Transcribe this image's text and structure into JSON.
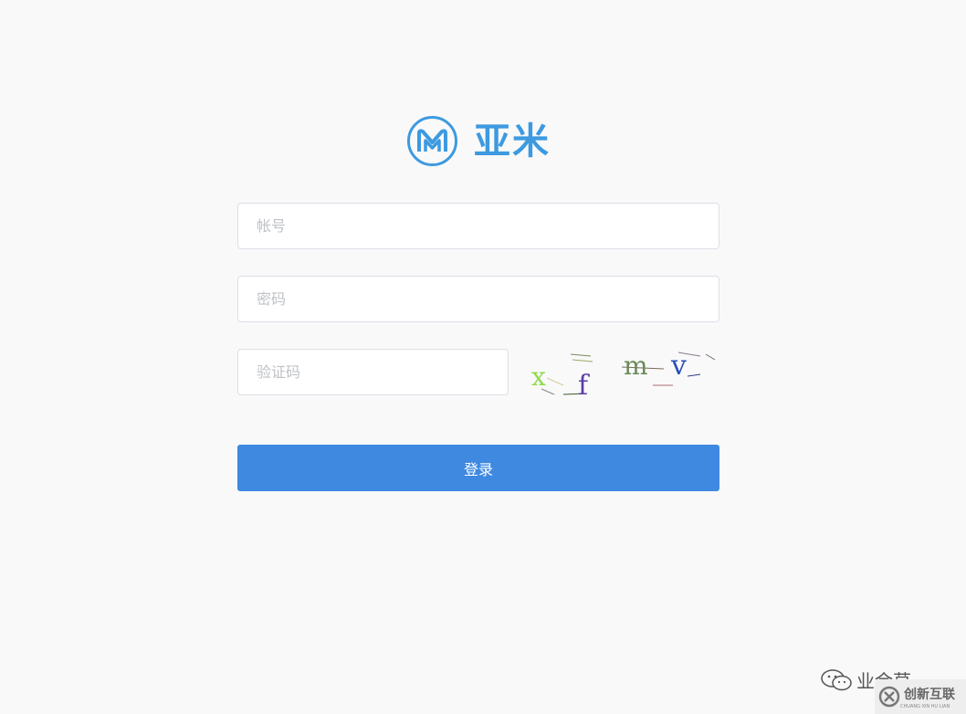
{
  "brand": {
    "name": "亚米",
    "color": "#3d9ae0"
  },
  "form": {
    "account_placeholder": "帐号",
    "password_placeholder": "密码",
    "captcha_placeholder": "验证码",
    "captcha_image_text": "xfmv",
    "login_label": "登录",
    "button_color": "#3f89e1"
  },
  "watermark": {
    "wechat_text": "业余草",
    "brand_text": "创新互联",
    "brand_subtext": "CHUANG XIN HU LIAN"
  }
}
